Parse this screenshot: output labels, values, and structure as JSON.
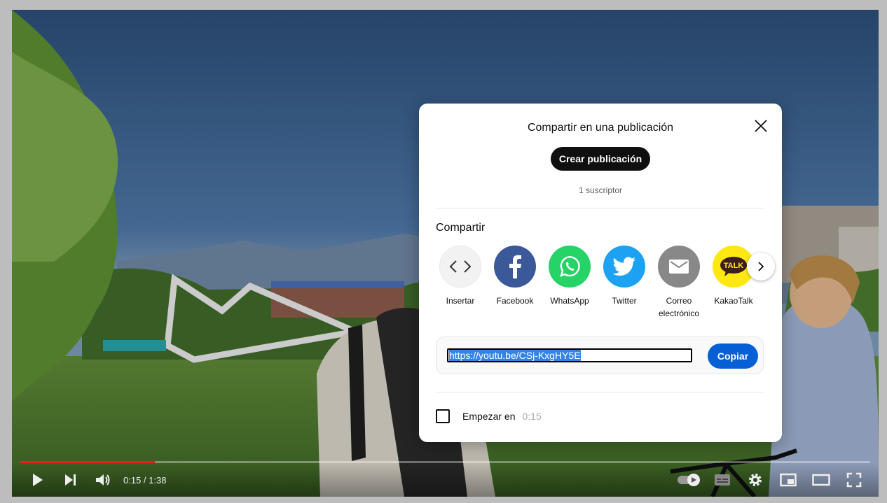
{
  "player": {
    "time_display": "0:15 / 1:38",
    "progress_fraction": 0.158,
    "progress_color": "#e62117"
  },
  "dialog": {
    "title": "Compartir en una publicación",
    "create_button": "Crear publicación",
    "subscribers": "1 suscriptor",
    "share_heading": "Compartir",
    "share_targets": [
      {
        "label": "Insertar",
        "icon": "embed-icon",
        "color": "#f2f2f2"
      },
      {
        "label": "Facebook",
        "icon": "facebook-icon",
        "color": "#3b5998"
      },
      {
        "label": "WhatsApp",
        "icon": "whatsapp-icon",
        "color": "#25d366"
      },
      {
        "label": "Twitter",
        "icon": "twitter-icon",
        "color": "#1da1f2"
      },
      {
        "label": "Correo electrónico",
        "icon": "email-icon",
        "color": "#888888"
      },
      {
        "label": "KakaoTalk",
        "icon": "kakaotalk-icon",
        "color": "#ffe812"
      }
    ],
    "url": "https://youtu.be/CSj-KxgHY5E",
    "copy_button": "Copiar",
    "start_at_label": "Empezar en",
    "start_at_time": "0:15"
  }
}
